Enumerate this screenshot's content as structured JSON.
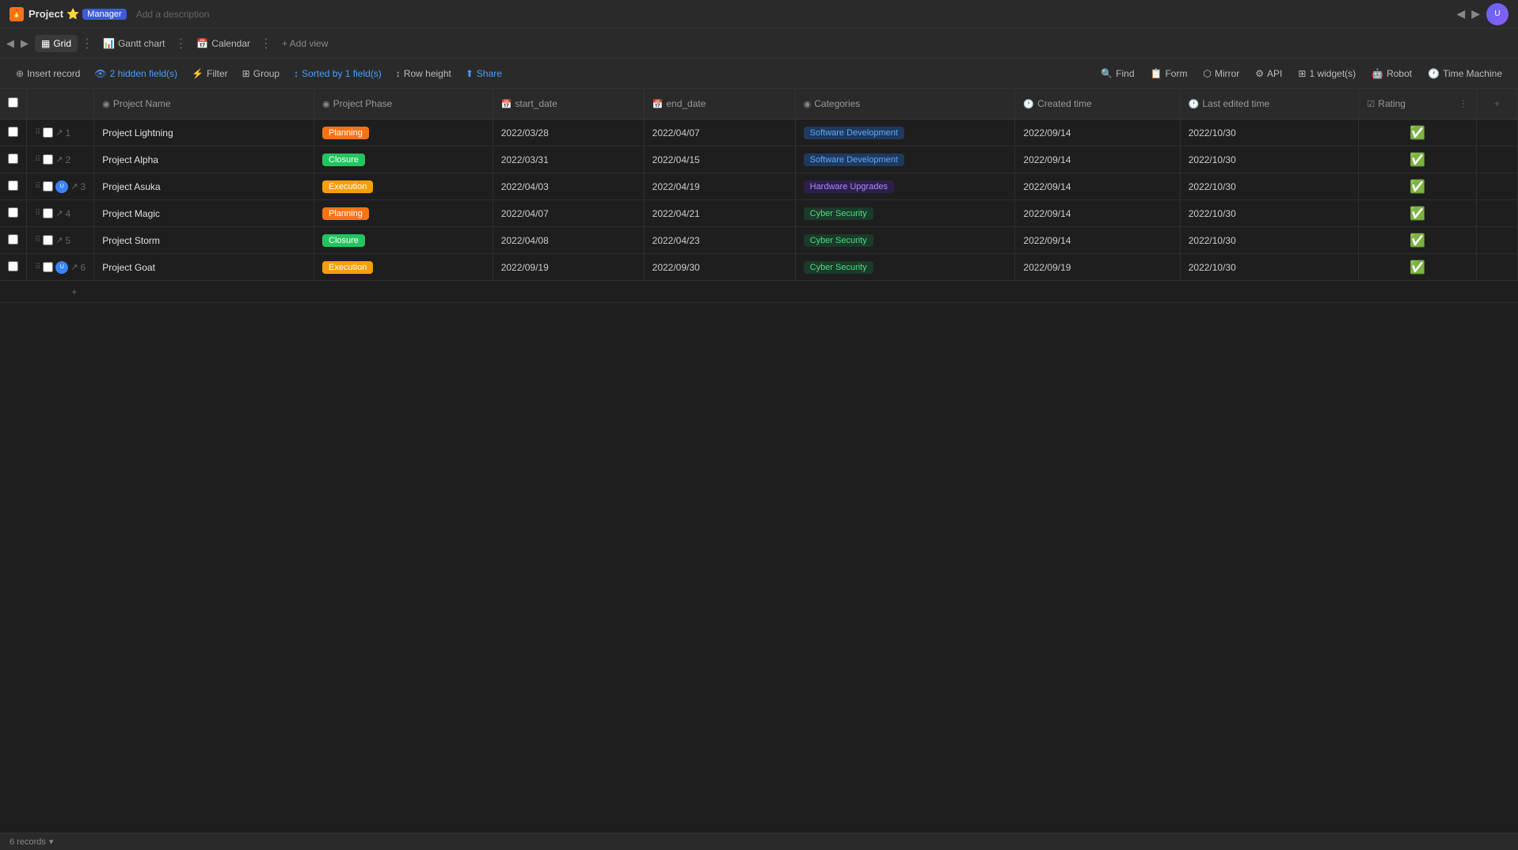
{
  "titleBar": {
    "appIcon": "🔥",
    "projectName": "Project",
    "starIcon": "⭐",
    "managerLabel": "Manager",
    "descriptionPlaceholder": "Add a description"
  },
  "navBar": {
    "items": [
      {
        "id": "grid",
        "label": "Grid",
        "icon": "▦",
        "active": true
      },
      {
        "id": "gantt",
        "label": "Gantt chart",
        "icon": "📊",
        "active": false
      },
      {
        "id": "calendar",
        "label": "Calendar",
        "icon": "📅",
        "active": false
      },
      {
        "id": "add-view",
        "label": "+ Add view",
        "active": false
      }
    ]
  },
  "toolbar": {
    "insertRecord": "Insert record",
    "hiddenFields": "2 hidden field(s)",
    "filter": "Filter",
    "group": "Group",
    "sortedBy": "Sorted by 1 field(s)",
    "rowHeight": "Row height",
    "share": "Share"
  },
  "toolbarRight": {
    "find": "Find",
    "form": "Form",
    "mirror": "Mirror",
    "api": "API",
    "widgets": "1 widget(s)",
    "robot": "Robot",
    "timeMachine": "Time Machine"
  },
  "table": {
    "columns": [
      {
        "id": "project-name",
        "label": "Project Name",
        "icon": "◉"
      },
      {
        "id": "project-phase",
        "label": "Project Phase",
        "icon": "◉"
      },
      {
        "id": "start-date",
        "label": "start_date",
        "icon": "📅"
      },
      {
        "id": "end-date",
        "label": "end_date",
        "icon": "📅"
      },
      {
        "id": "categories",
        "label": "Categories",
        "icon": "◉"
      },
      {
        "id": "created-time",
        "label": "Created time",
        "icon": "🕐"
      },
      {
        "id": "last-edited-time",
        "label": "Last edited time",
        "icon": "🕐"
      },
      {
        "id": "rating",
        "label": "Rating",
        "icon": "☑"
      }
    ],
    "rows": [
      {
        "id": 1,
        "name": "Project Lightning",
        "phase": "Planning",
        "phaseType": "planning",
        "startDate": "2022/03/28",
        "endDate": "2022/04/07",
        "category": "Software Development",
        "categoryType": "software",
        "createdTime": "2022/09/14",
        "lastEditedTime": "2022/10/30",
        "rating": true,
        "hasAvatar": false
      },
      {
        "id": 2,
        "name": "Project Alpha",
        "phase": "Closure",
        "phaseType": "closure",
        "startDate": "2022/03/31",
        "endDate": "2022/04/15",
        "category": "Software Development",
        "categoryType": "software",
        "createdTime": "2022/09/14",
        "lastEditedTime": "2022/10/30",
        "rating": true,
        "hasAvatar": false
      },
      {
        "id": 3,
        "name": "Project Asuka",
        "phase": "Execution",
        "phaseType": "execution",
        "startDate": "2022/04/03",
        "endDate": "2022/04/19",
        "category": "Hardware Upgrades",
        "categoryType": "hardware",
        "createdTime": "2022/09/14",
        "lastEditedTime": "2022/10/30",
        "rating": true,
        "hasAvatar": true,
        "avatarColor": "blue"
      },
      {
        "id": 4,
        "name": "Project Magic",
        "phase": "Planning",
        "phaseType": "planning",
        "startDate": "2022/04/07",
        "endDate": "2022/04/21",
        "category": "Cyber Security",
        "categoryType": "cyber",
        "createdTime": "2022/09/14",
        "lastEditedTime": "2022/10/30",
        "rating": true,
        "hasAvatar": false
      },
      {
        "id": 5,
        "name": "Project Storm",
        "phase": "Closure",
        "phaseType": "closure",
        "startDate": "2022/04/08",
        "endDate": "2022/04/23",
        "category": "Cyber Security",
        "categoryType": "cyber",
        "createdTime": "2022/09/14",
        "lastEditedTime": "2022/10/30",
        "rating": true,
        "hasAvatar": false
      },
      {
        "id": 6,
        "name": "Project Goat",
        "phase": "Execution",
        "phaseType": "execution",
        "startDate": "2022/09/19",
        "endDate": "2022/09/30",
        "category": "Cyber Security",
        "categoryType": "cyber",
        "createdTime": "2022/09/19",
        "lastEditedTime": "2022/10/30",
        "rating": true,
        "hasAvatar": true,
        "avatarColor": "blue"
      }
    ]
  },
  "footer": {
    "recordCount": "6 records",
    "dropdownIcon": "▾"
  }
}
